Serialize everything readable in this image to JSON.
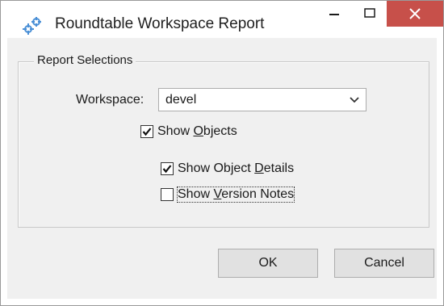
{
  "window": {
    "title": "Roundtable Workspace Report",
    "icon": "roundtable-app-icon",
    "close_color": "#c7504a"
  },
  "group": {
    "legend": "Report Selections"
  },
  "workspace": {
    "label": "Workspace:",
    "value": "devel"
  },
  "options": {
    "show_objects": {
      "pre": "Show ",
      "accel": "O",
      "post": "bjects",
      "checked": true
    },
    "show_object_details": {
      "pre": "Show Object ",
      "accel": "D",
      "post": "etails",
      "checked": true
    },
    "show_version_notes": {
      "pre": "Show ",
      "accel": "V",
      "post": "ersion Notes",
      "checked": false
    }
  },
  "buttons": {
    "ok": "OK",
    "cancel": "Cancel"
  }
}
